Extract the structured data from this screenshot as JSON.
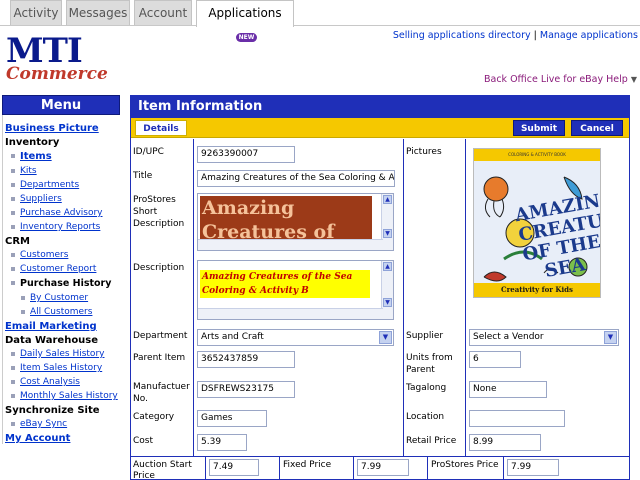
{
  "tabs": [
    {
      "label": "Activity"
    },
    {
      "label": "Messages"
    },
    {
      "label": "Account"
    },
    {
      "label": "Applications",
      "badge": "NEW"
    }
  ],
  "header": {
    "link_directory": "Selling applications directory",
    "link_separator": "|",
    "link_manage": "Manage applications",
    "help_link": "Back Office Live for eBay Help",
    "help_arrow": "▼"
  },
  "logo": {
    "mark": "MTI",
    "sub": "Commerce"
  },
  "menu": {
    "title": "Menu",
    "business_picture": "Business Picture",
    "inventory": "Inventory",
    "items": "Items",
    "kits": "Kits",
    "departments": "Departments",
    "suppliers": "Suppliers",
    "purchase_advisory": "Purchase Advisory",
    "inventory_reports": "Inventory Reports",
    "crm": "CRM",
    "customers": "Customers",
    "customer_report": "Customer Report",
    "purchase_history": "Purchase History",
    "by_customer": "By Customer",
    "all_customers": "All Customers",
    "email_marketing": "Email Marketing",
    "data_warehouse": "Data Warehouse",
    "daily_sales_history": "Daily Sales History",
    "item_sales_history": "Item Sales History",
    "cost_analysis": "Cost Analysis",
    "monthly_sales_history": "Monthly Sales History",
    "synchronize_site": "Synchronize Site",
    "ebay_sync": "eBay Sync",
    "my_account": "My Account"
  },
  "panel": {
    "title": "Item Information",
    "details_tab": "Details",
    "submit": "Submit",
    "cancel": "Cancel"
  },
  "form": {
    "id_upc_label": "ID/UPC",
    "id_upc_value": "9263390007",
    "title_label": "Title",
    "title_value": "Amazing Creatures of the Sea Coloring & Activity",
    "short_desc_label": "ProStores Short Description",
    "short_desc_value": "Amazing Creatures of the",
    "description_label": "Description",
    "description_value": "Amazing Creatures of the Sea Coloring & Activity B",
    "pictures_label": "Pictures",
    "department_label": "Department",
    "department_value": "Arts and Craft",
    "supplier_label": "Supplier",
    "supplier_value": "Select a Vendor",
    "parent_item_label": "Parent Item",
    "parent_item_value": "3652437859",
    "units_from_parent_label": "Units from Parent",
    "units_from_parent_value": "6",
    "manufacturer_label": "Manufactuer No.",
    "manufacturer_value": "DSFREWS23175",
    "tagalong_label": "Tagalong",
    "tagalong_value": "None",
    "category_label": "Category",
    "category_value": "Games",
    "location_label": "Location",
    "location_value": "",
    "cost_label": "Cost",
    "cost_value": "5.39",
    "retail_price_label": "Retail Price",
    "retail_price_value": "8.99",
    "auction_start_label": "Auction Start Price",
    "auction_start_value": "7.49",
    "fixed_price_label": "Fixed Price",
    "fixed_price_value": "7.99",
    "prostores_price_label": "ProStores Price",
    "prostores_price_value": "7.99"
  },
  "cover": {
    "top_text": "COLORING & ACTIVITY BOOK",
    "title": "AMAZING CREATURES OF THE SEA",
    "footer": "Creativity for Kids"
  },
  "colors": {
    "brand_blue": "#1f2fb8",
    "toolbar_yellow": "#f5c800",
    "link_blue": "#0033cc",
    "help_purple": "#8a1a7a"
  }
}
